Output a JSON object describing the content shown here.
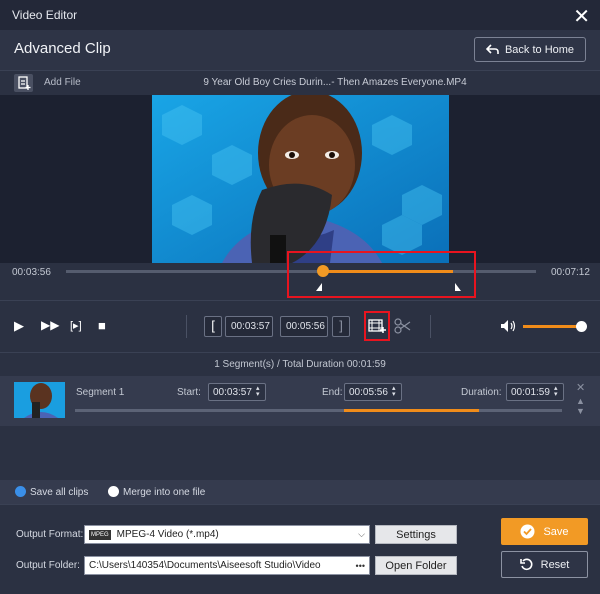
{
  "window": {
    "title": "Video Editor",
    "close_glyph": "✕"
  },
  "header": {
    "title": "Advanced Clip",
    "back_label": "Back to Home"
  },
  "filebar": {
    "add_label": "Add File",
    "file_name": "9 Year Old Boy Cries Durin...- Then Amazes Everyone.MP4"
  },
  "timeline": {
    "start_time": "00:03:56",
    "end_time": "00:07:12"
  },
  "controls": {
    "start_time": "00:03:57",
    "end_time": "00:05:56",
    "volume_level": 1.0
  },
  "segments": {
    "summary": "1 Segment(s) / Total Duration 00:01:59",
    "items": [
      {
        "name": "Segment 1",
        "start_label": "Start:",
        "start": "00:03:57",
        "end_label": "End:",
        "end": "00:05:56",
        "duration_label": "Duration:",
        "duration": "00:01:59"
      }
    ]
  },
  "save_options": {
    "save_all": "Save all clips",
    "merge": "Merge into one file",
    "selected": "save_all"
  },
  "output": {
    "format_label": "Output Format:",
    "format_value": "MPEG-4 Video (*.mp4)",
    "format_icon_text": "MPEG",
    "settings_label": "Settings",
    "folder_label": "Output Folder:",
    "folder_value": "C:\\Users\\140354\\Documents\\Aiseesoft Studio\\Video",
    "folder_dots": "•••",
    "open_folder_label": "Open Folder",
    "save_label": "Save",
    "reset_label": "Reset"
  },
  "colors": {
    "accent": "#f29a25",
    "highlight_box": "#e8141f",
    "background": "#2b3142"
  }
}
